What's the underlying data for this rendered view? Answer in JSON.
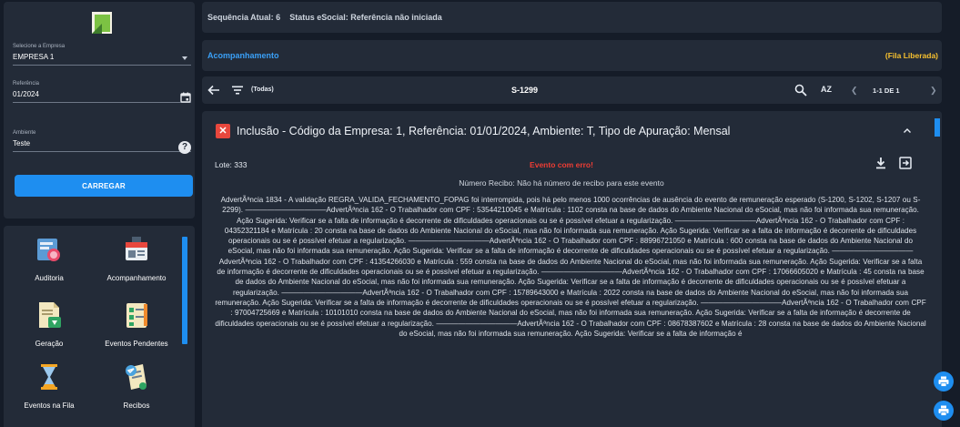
{
  "sidebar": {
    "empresa": {
      "label": "Selecione a Empresa",
      "value": "EMPRESA 1"
    },
    "referencia": {
      "label": "Referência",
      "value": "01/2024"
    },
    "ambiente": {
      "label": "Ambiente",
      "value": "Teste"
    },
    "carregar_label": "CARREGAR",
    "menu": [
      {
        "label": "Auditoria",
        "icon": "audit-icon"
      },
      {
        "label": "Acompanhamento",
        "icon": "news-icon"
      },
      {
        "label": "Geração",
        "icon": "document-download-icon"
      },
      {
        "label": "Eventos Pendentes",
        "icon": "checklist-icon"
      },
      {
        "label": "Eventos na Fila",
        "icon": "hourglass-icon"
      },
      {
        "label": "Recibos",
        "icon": "receipt-icon"
      }
    ]
  },
  "header": {
    "sequencia": "Sequência Atual: 6",
    "status_esocial": "Status eSocial: Referência não iniciada"
  },
  "acompanhamento": {
    "title": "Acompanhamento",
    "fila_status": "(Fila Liberada)"
  },
  "toolbar": {
    "filter_label": "(Todas)",
    "event_code": "S-1299",
    "sort_label": "AZ",
    "pagination": "1-1 DE 1"
  },
  "event": {
    "title": "Inclusão - Código da Empresa: 1, Referência: 01/01/2024, Ambiente: T, Tipo de Apuração: Mensal",
    "lote": "Lote: 333",
    "status": "Evento com erro!",
    "recibo": "Número Recibo: Não há número de recibo para este evento",
    "message": "AdvertÃªncia 1834 - A validação REGRA_VALIDA_FECHAMENTO_FOPAG foi interrompida, pois há pelo menos 1000 ocorrências de ausência do evento de remuneração esperado (S-1200, S-1202, S-1207 ou S-2299). ———————————AdvertÃªncia 162 - O Trabalhador com CPF : 53544210045 e Matrícula : 1102 consta na base de dados do Ambiente Nacional do eSocial, mas não foi informada sua remuneração. Ação Sugerida: Verificar se a falta de informação é decorrente de dificuldades operacionais ou se é possível efetuar a regularização. ———————————AdvertÃªncia 162 - O Trabalhador com CPF : 04352321184 e Matrícula : 20 consta na base de dados do Ambiente Nacional do eSocial, mas não foi informada sua remuneração. Ação Sugerida: Verificar se a falta de informação é decorrente de dificuldades operacionais ou se é possível efetuar a regularização. ———————————AdvertÃªncia 162 - O Trabalhador com CPF : 88996721050 e Matrícula : 600 consta na base de dados do Ambiente Nacional do eSocial, mas não foi informada sua remuneração. Ação Sugerida: Verificar se a falta de informação é decorrente de dificuldades operacionais ou se é possível efetuar a regularização. ———————————AdvertÃªncia 162 - O Trabalhador com CPF : 41354266030 e Matrícula : 559 consta na base de dados do Ambiente Nacional do eSocial, mas não foi informada sua remuneração. Ação Sugerida: Verificar se a falta de informação é decorrente de dificuldades operacionais ou se é possível efetuar a regularização. ———————————AdvertÃªncia 162 - O Trabalhador com CPF : 17066605020 e Matrícula : 45 consta na base de dados do Ambiente Nacional do eSocial, mas não foi informada sua remuneração. Ação Sugerida: Verificar se a falta de informação é decorrente de dificuldades operacionais ou se é possível efetuar a regularização. ———————————AdvertÃªncia 162 - O Trabalhador com CPF : 15789643000 e Matrícula : 2022 consta na base de dados do Ambiente Nacional do eSocial, mas não foi informada sua remuneração. Ação Sugerida: Verificar se a falta de informação é decorrente de dificuldades operacionais ou se é possível efetuar a regularização. ———————————AdvertÃªncia 162 - O Trabalhador com CPF : 97004725669 e Matrícula : 10101010 consta na base de dados do Ambiente Nacional do eSocial, mas não foi informada sua remuneração. Ação Sugerida: Verificar se a falta de informação é decorrente de dificuldades operacionais ou se é possível efetuar a regularização. ———————————AdvertÃªncia 162 - O Trabalhador com CPF : 08678387602 e Matrícula : 28 consta na base de dados do Ambiente Nacional do eSocial, mas não foi informada sua remuneração. Ação Sugerida: Verificar se a falta de informação é"
  },
  "colors": {
    "background": "#151c28",
    "panel": "#232b38",
    "accent": "#1e8ef0",
    "warning": "#f7c12f",
    "error": "#ef3d34"
  }
}
